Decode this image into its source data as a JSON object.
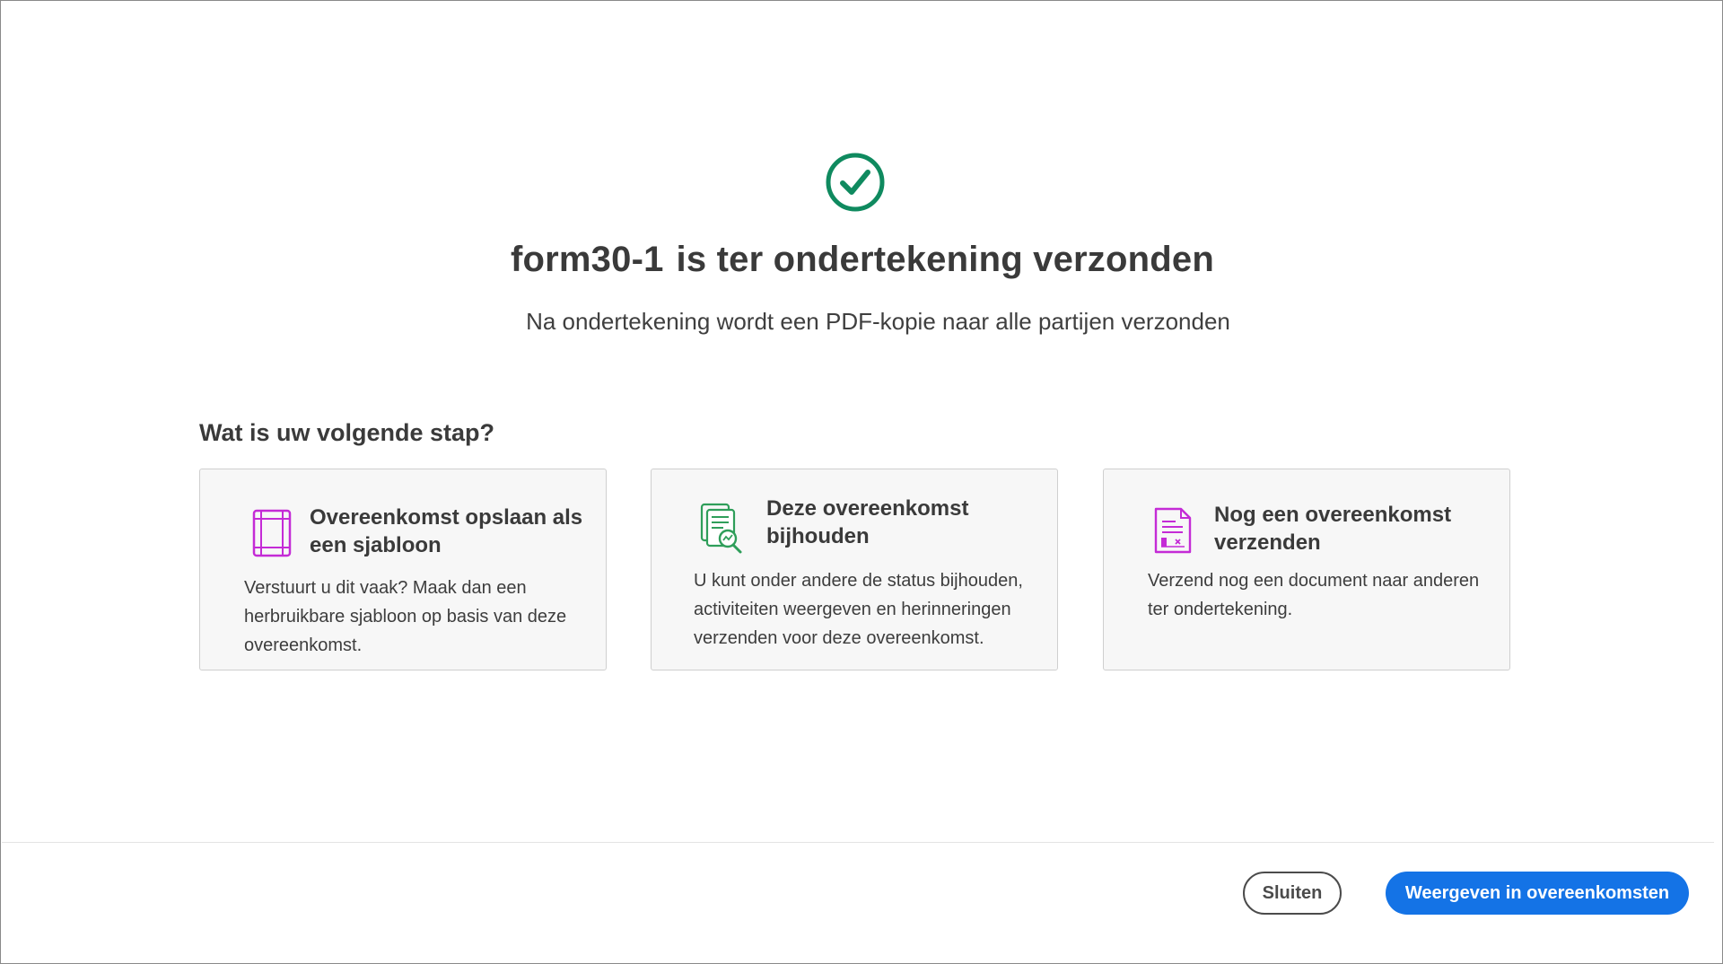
{
  "dialog": {
    "status_icon": "check-circle-icon",
    "title_doc_name": "form30-1",
    "title_suffix": "is ter ondertekening verzonden",
    "subtitle": "Na ondertekening wordt een PDF-kopie naar alle partijen verzonden"
  },
  "next_steps": {
    "heading": "Wat is uw volgende stap?",
    "cards": [
      {
        "icon": "template-icon",
        "title": "Overeenkomst opslaan als een sjabloon",
        "description": "Verstuurt u dit vaak? Maak dan een herbruikbare sjabloon op basis van deze overeenkomst."
      },
      {
        "icon": "track-document-icon",
        "title": "Deze overeenkomst bijhouden",
        "description": "U kunt onder andere de status bijhouden, activiteiten weergeven en herinneringen verzenden voor deze overeenkomst."
      },
      {
        "icon": "send-document-icon",
        "title": "Nog een overeenkomst verzenden",
        "description": "Verzend nog een document naar anderen ter ondertekening."
      }
    ]
  },
  "footer": {
    "close_label": "Sluiten",
    "primary_label": "Weergeven in overeenkomsten"
  },
  "colors": {
    "success": "#0f8a5f",
    "accent": "#1473e6",
    "magenta": "#c42bd6",
    "green": "#2f9e5a"
  }
}
